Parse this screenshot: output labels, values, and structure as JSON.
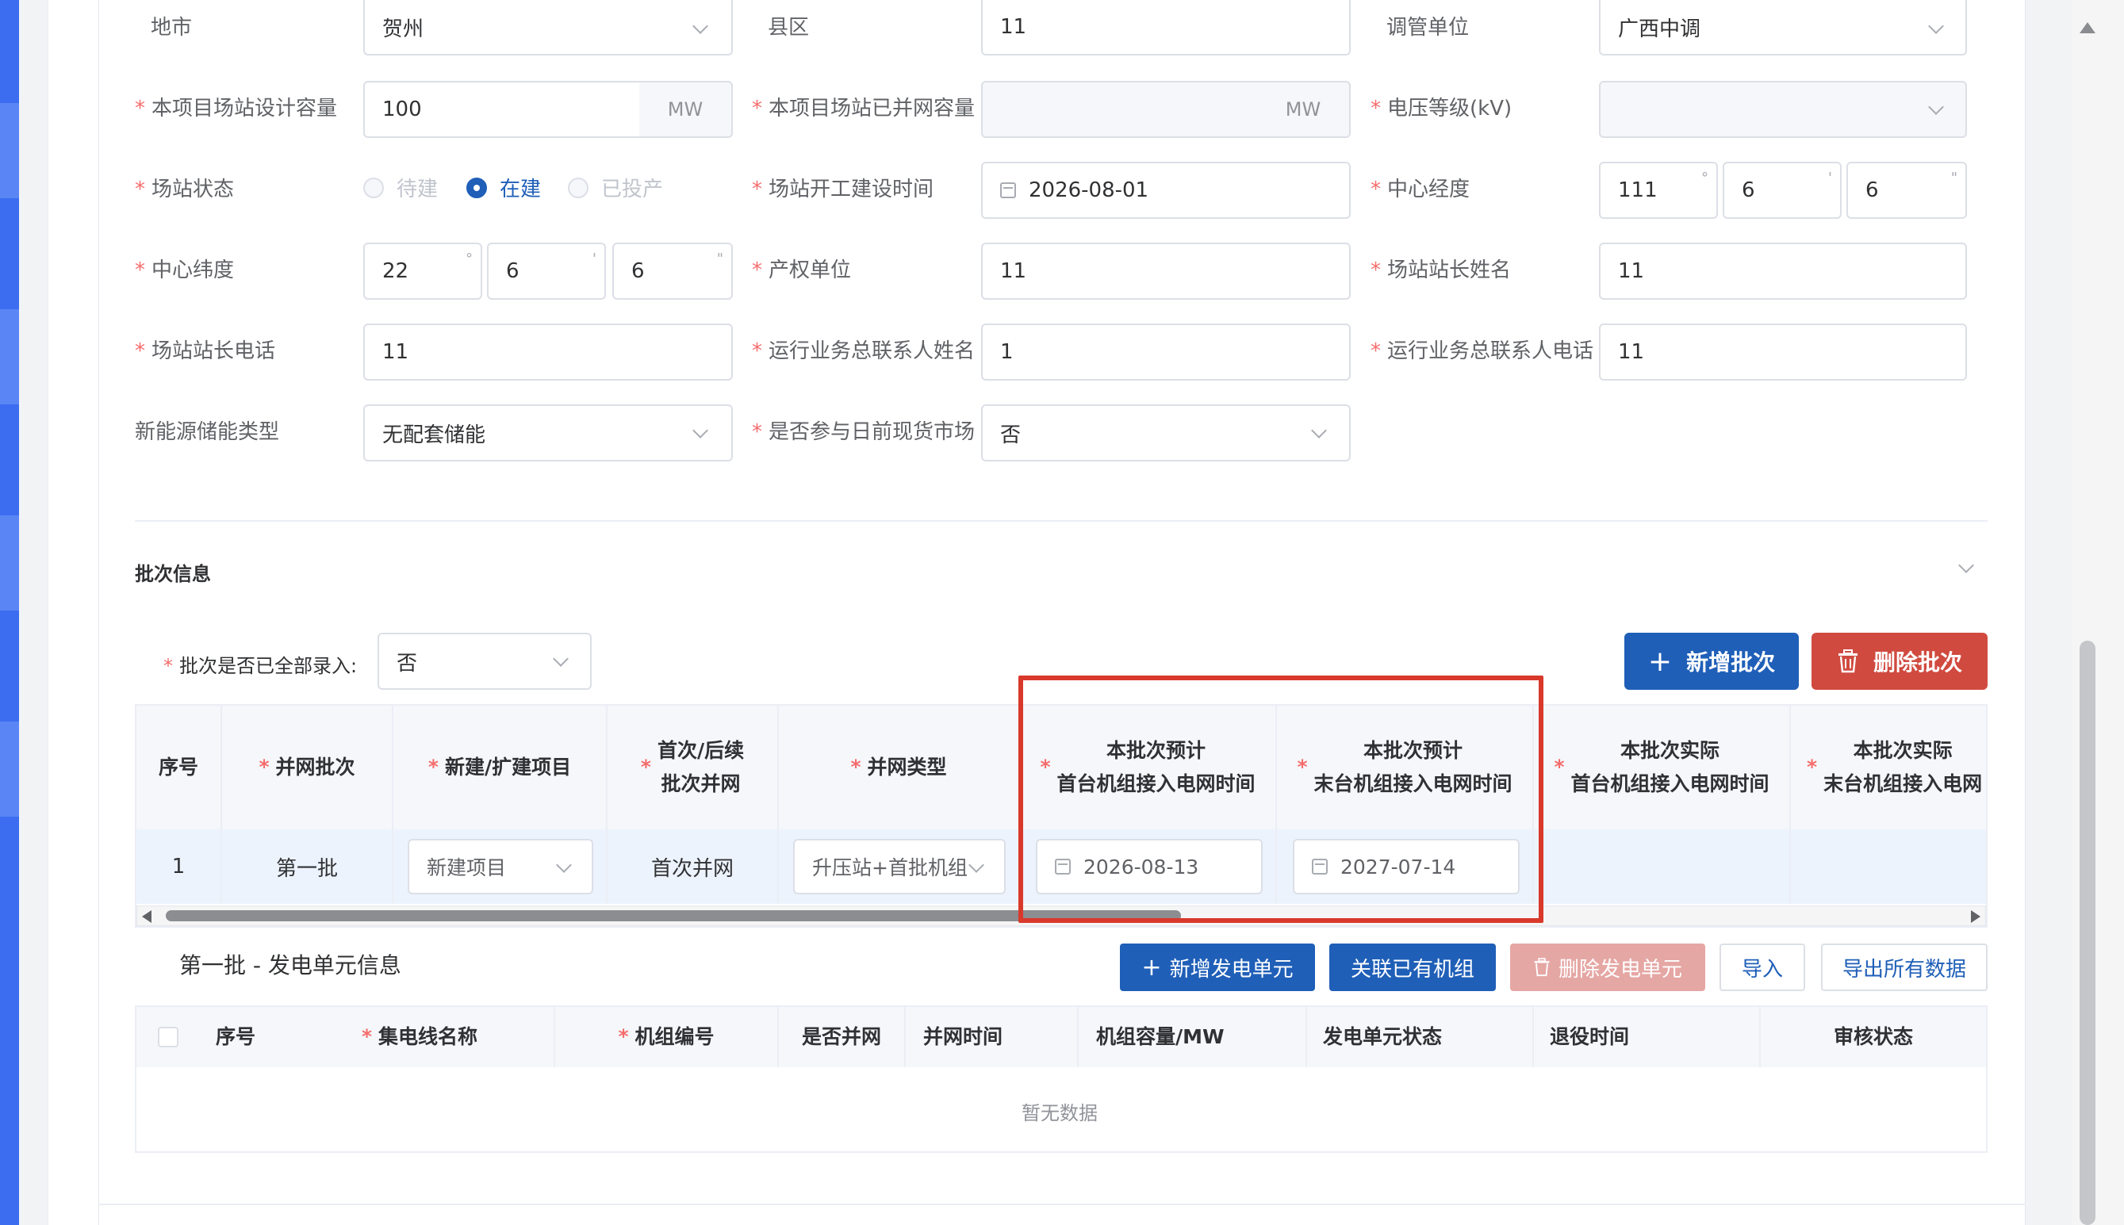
{
  "colors": {
    "primary": "#1f5fb8",
    "danger": "#d04a3f",
    "required": "#f56c6c",
    "highlight": "#d8392b"
  },
  "form": {
    "row0": {
      "city_label": "地市",
      "city_value": "贺州",
      "county_label": "县区",
      "county_value": "11",
      "dispatch_label": "调管单位",
      "dispatch_value": "广西中调"
    },
    "design_capacity": {
      "label": "本项目场站设计容量",
      "value": "100",
      "unit": "MW"
    },
    "connected_capacity": {
      "label": "本项目场站已并网容量",
      "value": "",
      "unit": "MW"
    },
    "voltage_level": {
      "label": "电压等级(kV)",
      "value": ""
    },
    "station_status": {
      "label": "场站状态",
      "options": [
        "待建",
        "在建",
        "已投产"
      ],
      "selected": "在建"
    },
    "construction_start": {
      "label": "场站开工建设时间",
      "value": "2026-08-01"
    },
    "center_longitude": {
      "label": "中心经度",
      "deg": "111",
      "min": "6",
      "sec": "6"
    },
    "center_latitude": {
      "label": "中心纬度",
      "deg": "22",
      "min": "6",
      "sec": "6"
    },
    "property_unit": {
      "label": "产权单位",
      "value": "11"
    },
    "station_manager_name": {
      "label": "场站站长姓名",
      "value": "11"
    },
    "station_manager_phone": {
      "label": "场站站长电话",
      "value": "11"
    },
    "ops_contact_name": {
      "label": "运行业务总联系人姓名",
      "value": "1"
    },
    "ops_contact_phone": {
      "label": "运行业务总联系人电话",
      "value": "11"
    },
    "storage_type": {
      "label": "新能源储能类型",
      "value": "无配套储能"
    },
    "spot_market": {
      "label": "是否参与日前现货市场",
      "value": "否"
    },
    "unit_marks": {
      "deg": "°",
      "min": "'",
      "sec": "\""
    }
  },
  "batch": {
    "section_title": "批次信息",
    "all_entered_label": "批次是否已全部录入:",
    "all_entered_value": "否",
    "add_button": "新增批次",
    "delete_button": "删除批次",
    "columns": {
      "index": "序号",
      "batch": "并网批次",
      "project_type": "新建/扩建项目",
      "first_follow": "首次/后续\n批次并网",
      "grid_type": "并网类型",
      "plan_first": "本批次预计\n首台机组接入电网时间",
      "plan_last": "本批次预计\n末台机组接入电网时间",
      "actual_first": "本批次实际\n首台机组接入电网时间",
      "actual_last": "本批次实际\n末台机组接入电网"
    },
    "rows": [
      {
        "index": "1",
        "batch": "第一批",
        "project_type": "新建项目",
        "first_follow": "首次并网",
        "grid_type": "升压站+首批机组",
        "plan_first": "2026-08-13",
        "plan_last": "2027-07-14"
      }
    ]
  },
  "units": {
    "title": "第一批 - 发电单元信息",
    "buttons": {
      "add": "新增发电单元",
      "link": "关联已有机组",
      "delete": "删除发电单元",
      "import": "导入",
      "export": "导出所有数据"
    },
    "columns": [
      "序号",
      "集电线名称",
      "机组编号",
      "是否并网",
      "并网时间",
      "机组容量/MW",
      "发电单元状态",
      "退役时间",
      "审核状态"
    ],
    "empty_text": "暂无数据"
  }
}
